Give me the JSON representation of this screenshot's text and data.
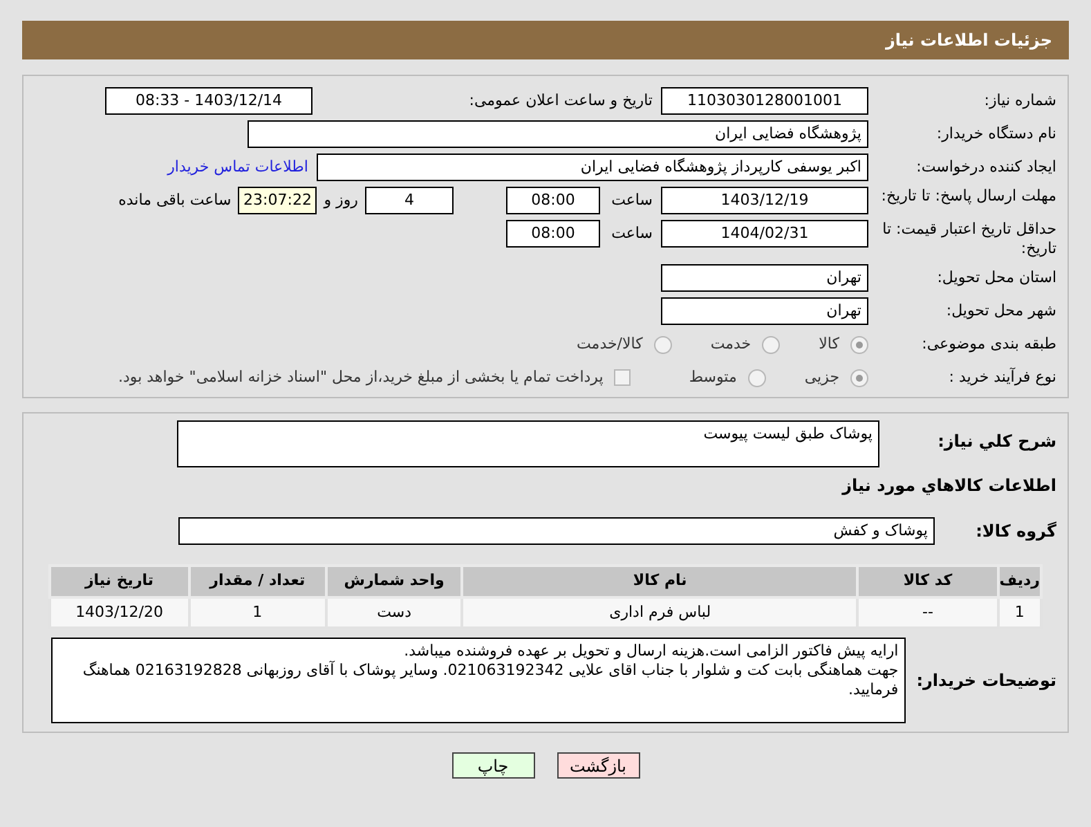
{
  "header": {
    "title": "جزئیات اطلاعات نیاز"
  },
  "need_number": {
    "label": "شماره نیاز:",
    "value": "1103030128001001"
  },
  "announce_datetime": {
    "label": "تاریخ و ساعت اعلان عمومی:",
    "value": "1403/12/14 - 08:33"
  },
  "buyer_org": {
    "label": "نام دستگاه خریدار:",
    "value": "پژوهشگاه فضایی ایران"
  },
  "requester": {
    "label": "ایجاد کننده درخواست:",
    "value": "اکبر یوسفی کارپرداز پژوهشگاه فضایی ایران",
    "link": "اطلاعات تماس خریدار"
  },
  "response_deadline": {
    "label": "مهلت ارسال پاسخ: تا تاریخ:",
    "date": "1403/12/19",
    "time_label": "ساعت",
    "time": "08:00",
    "days": "4",
    "days_label": "روز و",
    "remaining": "23:07:22",
    "remaining_label": "ساعت باقی مانده"
  },
  "price_validity": {
    "label": "حداقل تاریخ اعتبار قیمت: تا تاریخ:",
    "date": "1404/02/31",
    "time_label": "ساعت",
    "time": "08:00"
  },
  "province": {
    "label": "استان محل تحویل:",
    "value": "تهران"
  },
  "city": {
    "label": "شهر محل تحویل:",
    "value": "تهران"
  },
  "category": {
    "label": "طبقه بندی موضوعی:",
    "options": [
      {
        "label": "کالا",
        "selected": true
      },
      {
        "label": "خدمت",
        "selected": false
      },
      {
        "label": "کالا/خدمت",
        "selected": false
      }
    ]
  },
  "purchase_process": {
    "label": "نوع فرآیند خرید :",
    "options": [
      {
        "label": "جزیی",
        "selected": true
      },
      {
        "label": "متوسط",
        "selected": false
      }
    ],
    "treasury_checkbox": {
      "label": "پرداخت تمام یا بخشی از مبلغ خرید،از محل \"اسناد خزانه اسلامی\" خواهد بود.",
      "checked": false
    }
  },
  "general_description": {
    "label": "شرح کلي نياز:",
    "value": "پوشاک طبق لیست پیوست"
  },
  "goods_heading": "اطلاعات کالاهاي مورد نياز",
  "goods_group": {
    "label": "گروه کالا:",
    "value": "پوشاک و کفش"
  },
  "table": {
    "columns": [
      "ردیف",
      "کد کالا",
      "نام کالا",
      "واحد شمارش",
      "تعداد / مقدار",
      "تاریخ نیاز"
    ],
    "rows": [
      [
        "1",
        "--",
        "لباس فرم اداری",
        "دست",
        "1",
        "1403/12/20"
      ]
    ]
  },
  "buyer_notes": {
    "label": "توضیحات خریدار:",
    "lines": [
      "ارایه پیش فاکتور الزامی است.هزینه ارسال و تحویل بر عهده فروشنده میباشد.",
      "جهت هماهنگی بابت کت و شلوار با جناب اقای علایی 021063192342. وسایر پوشاک با آقای روزبهانی 02163192828 هماهنگ فرمایید."
    ]
  },
  "buttons": [
    {
      "label": "بازگشت",
      "kind": "back"
    },
    {
      "label": "چاپ",
      "kind": "print"
    }
  ]
}
